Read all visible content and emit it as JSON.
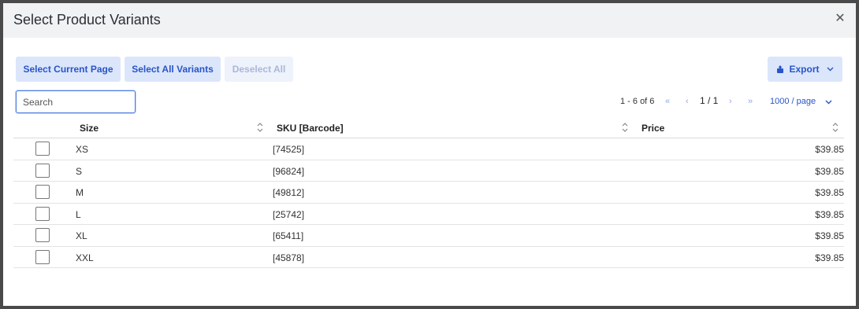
{
  "modal": {
    "title": "Select Product Variants",
    "close_glyph": "✕"
  },
  "toolbar": {
    "select_current_page": "Select Current Page",
    "select_all_variants": "Select All Variants",
    "deselect_all": "Deselect All",
    "export_label": "Export",
    "export_icon": "export-icon",
    "export_chevron": "⌄"
  },
  "search": {
    "placeholder": "Search",
    "value": ""
  },
  "pagination": {
    "range": "1 - 6 of 6",
    "first": "«",
    "prev": "‹",
    "page": "1 / 1",
    "next": "›",
    "last": "»",
    "page_size": "1000 / page",
    "page_size_chevron": "⌄"
  },
  "table": {
    "columns": [
      {
        "label": "Size",
        "sortable": true
      },
      {
        "label": "SKU [Barcode]",
        "sortable": true
      },
      {
        "label": "Price",
        "sortable": true
      }
    ],
    "rows": [
      {
        "size": "XS",
        "sku": "[74525]",
        "price": "$39.85",
        "checked": false
      },
      {
        "size": "S",
        "sku": "[96824]",
        "price": "$39.85",
        "checked": false
      },
      {
        "size": "M",
        "sku": "[49812]",
        "price": "$39.85",
        "checked": false
      },
      {
        "size": "L",
        "sku": "[25742]",
        "price": "$39.85",
        "checked": false
      },
      {
        "size": "XL",
        "sku": "[65411]",
        "price": "$39.85",
        "checked": false
      },
      {
        "size": "XXL",
        "sku": "[45878]",
        "price": "$39.85",
        "checked": false
      }
    ]
  },
  "colors": {
    "accent": "#2a54c8",
    "button_bg": "#dbe6fb",
    "header_bg": "#f1f2f4"
  }
}
